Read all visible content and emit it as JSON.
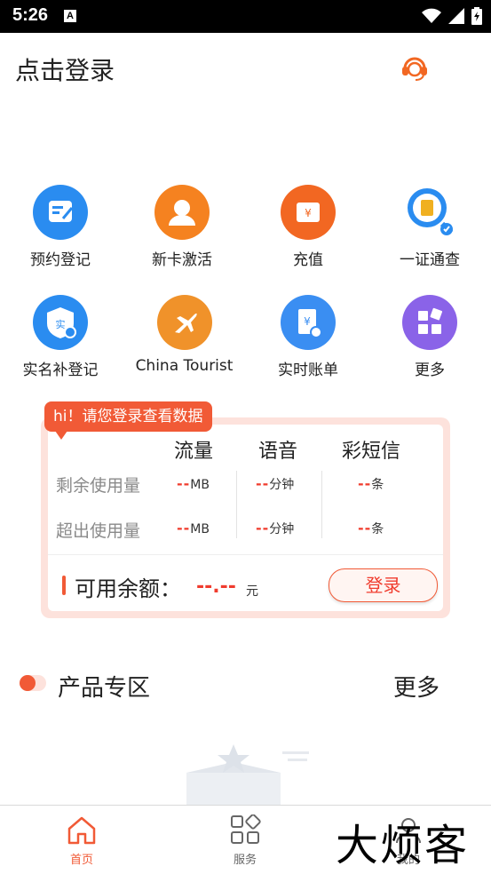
{
  "status_bar": {
    "time": "5:26",
    "notification_icon": "A"
  },
  "header": {
    "title": "点击登录",
    "service_icon": "customer-service-icon"
  },
  "grid_items": [
    {
      "label": "预约登记",
      "color": "#2a8cf0",
      "icon": "form-icon"
    },
    {
      "label": "新卡激活",
      "color": "#f58220",
      "icon": "user-icon"
    },
    {
      "label": "充值",
      "color": "#f26722",
      "icon": "wallet-icon"
    },
    {
      "label": "一证通查",
      "color": "#2a8cf0",
      "icon": "id-search-icon"
    },
    {
      "label": "实名补登记",
      "color": "#2a8cf0",
      "icon": "shield-icon"
    },
    {
      "label": "China Tourist",
      "color": "#f0922a",
      "icon": "plane-icon"
    },
    {
      "label": "实时账单",
      "color": "#3a8ef2",
      "icon": "bill-icon"
    },
    {
      "label": "更多",
      "color": "#8a63e8",
      "icon": "more-grid-icon"
    }
  ],
  "usage_card": {
    "tag": "hi！请您登录查看数据",
    "columns": [
      "流量",
      "语音",
      "彩短信"
    ],
    "rows": [
      {
        "label": "剩余使用量",
        "values": [
          {
            "dash": "--",
            "unit": "MB"
          },
          {
            "dash": "--",
            "unit": "分钟"
          },
          {
            "dash": "--",
            "unit": "条"
          }
        ]
      },
      {
        "label": "超出使用量",
        "values": [
          {
            "dash": "--",
            "unit": "MB"
          },
          {
            "dash": "--",
            "unit": "分钟"
          },
          {
            "dash": "--",
            "unit": "条"
          }
        ]
      }
    ],
    "balance_label": "可用余额：",
    "balance_value": "--.--",
    "balance_unit": "元",
    "login_label": "登录"
  },
  "products": {
    "title": "产品专区",
    "more": "更多"
  },
  "tabs": [
    {
      "label": "首页",
      "icon": "home-icon",
      "active": true
    },
    {
      "label": "服务",
      "icon": "grid-icon",
      "active": false
    },
    {
      "label": "我的",
      "icon": "profile-icon",
      "active": false
    }
  ],
  "watermark": "大烦客",
  "colors": {
    "accent": "#f15a36",
    "dash_red": "#f03c2e",
    "card_bg": "#fde2dc"
  }
}
